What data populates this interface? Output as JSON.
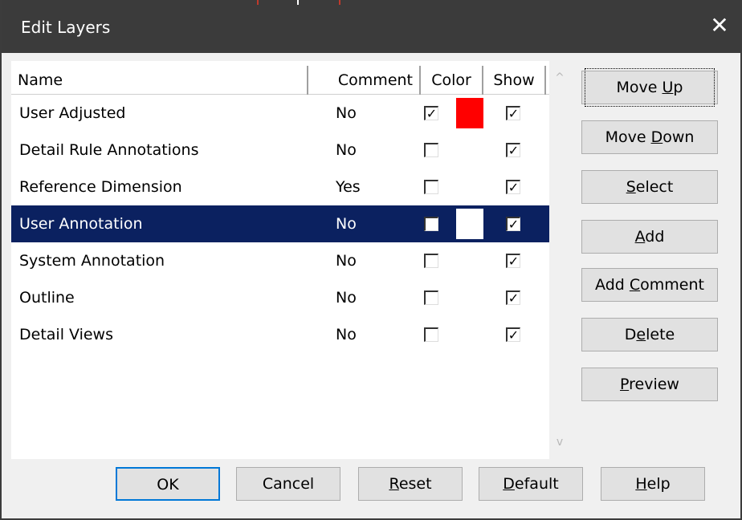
{
  "window": {
    "title": "Edit Layers",
    "close_glyph": "✕"
  },
  "list": {
    "columns": [
      "Name",
      "Comment",
      "Color",
      "Show"
    ],
    "rows": [
      {
        "name": "User Adjusted",
        "comment": "No",
        "color_checked": true,
        "swatch": "#ff0000",
        "show": true
      },
      {
        "name": "Detail Rule Annotations",
        "comment": "No",
        "color_checked": false,
        "swatch": null,
        "show": true
      },
      {
        "name": "Reference Dimension",
        "comment": "Yes",
        "color_checked": false,
        "swatch": null,
        "show": true
      },
      {
        "name": "User Annotation",
        "comment": "No",
        "color_checked": false,
        "swatch": "#ffffff",
        "show": true,
        "selected": true
      },
      {
        "name": "System Annotation",
        "comment": "No",
        "color_checked": false,
        "swatch": null,
        "show": true
      },
      {
        "name": "Outline",
        "comment": "No",
        "color_checked": false,
        "swatch": null,
        "show": true
      },
      {
        "name": "Detail Views",
        "comment": "No",
        "color_checked": false,
        "swatch": null,
        "show": true
      }
    ],
    "scroll_up_glyph": "^",
    "scroll_down_glyph": "v"
  },
  "side_buttons": {
    "move_up": {
      "pre": "Move ",
      "key": "U",
      "post": "p"
    },
    "move_down": {
      "pre": "Move ",
      "key": "D",
      "post": "own"
    },
    "select": {
      "pre": "",
      "key": "S",
      "post": "elect"
    },
    "add": {
      "pre": "",
      "key": "A",
      "post": "dd"
    },
    "add_comment": {
      "pre": "Add ",
      "key": "C",
      "post": "omment"
    },
    "delete": {
      "pre": "D",
      "key": "e",
      "post": "lete"
    },
    "preview": {
      "pre": "",
      "key": "P",
      "post": "review"
    }
  },
  "bottom_buttons": {
    "ok": "OK",
    "cancel": "Cancel",
    "reset": {
      "pre": "",
      "key": "R",
      "post": "eset"
    },
    "default": {
      "pre": "",
      "key": "D",
      "post": "efault"
    },
    "help": {
      "pre": "",
      "key": "H",
      "post": "elp"
    }
  },
  "check_glyph": "✓",
  "colors": {
    "titlebar": "#3b3b3b",
    "selection": "#0b2160",
    "focus_border": "#0078d7"
  }
}
